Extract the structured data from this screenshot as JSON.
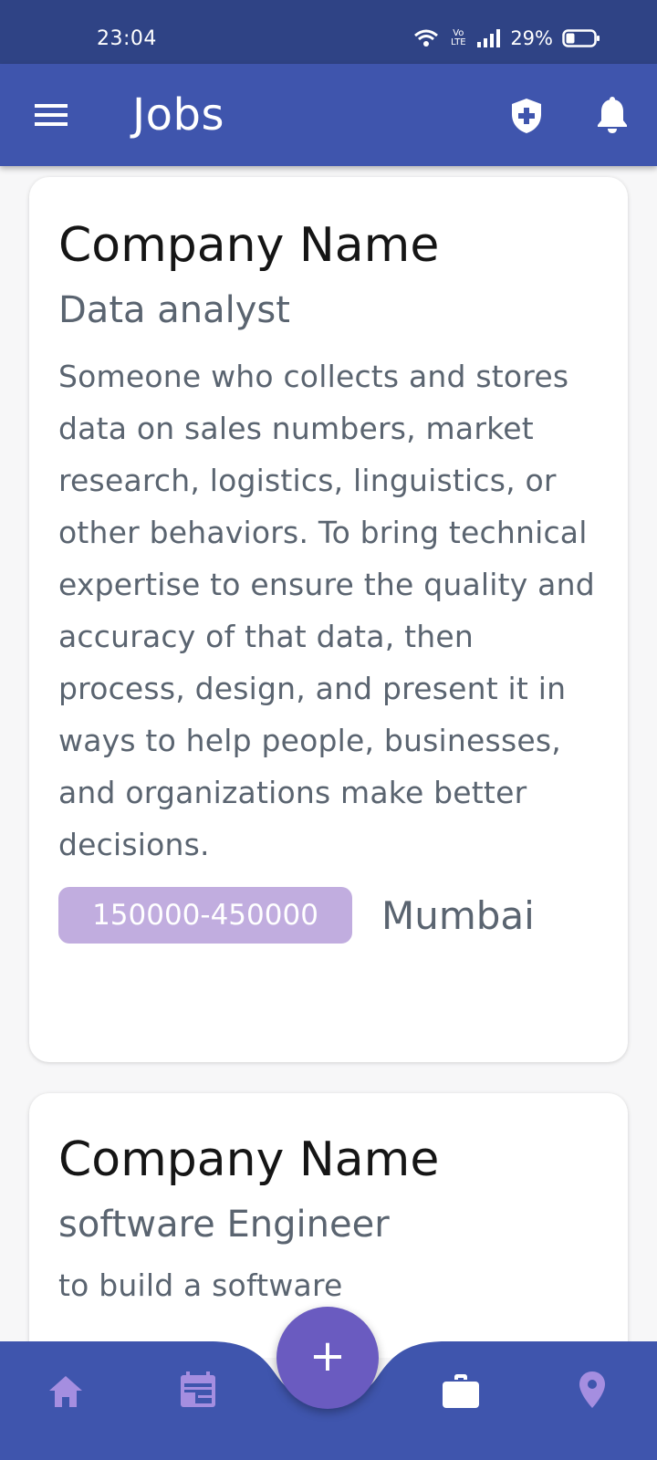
{
  "status_bar": {
    "time": "23:04",
    "battery": "29%",
    "network": "Vo LTE"
  },
  "app_bar": {
    "title": "Jobs"
  },
  "jobs": [
    {
      "company": "Company Name",
      "title": "Data analyst",
      "description": "Someone who collects and stores data on sales numbers, market research, logistics, linguistics, or other behaviors. To bring technical expertise to ensure the quality and accuracy of that data, then process, design, and present it in ways to help people, businesses, and organizations make better decisions.",
      "salary": "150000-450000",
      "location": "Mumbai"
    },
    {
      "company": "Company Name",
      "title": "software Engineer",
      "description": "to build a software"
    }
  ],
  "fab": {
    "label": "+"
  },
  "bottom_nav": {
    "items": [
      "home-icon",
      "calendar-icon",
      "briefcase-icon",
      "location-pin-icon"
    ],
    "colors": {
      "bar": "#3f55ad",
      "inactive": "#a58ee0",
      "active": "#ffffff"
    }
  },
  "colors": {
    "status_bar": "#2f4385",
    "app_bar": "#3f55ad",
    "chip": "#c1addf",
    "fab": "#6a5bc0"
  }
}
